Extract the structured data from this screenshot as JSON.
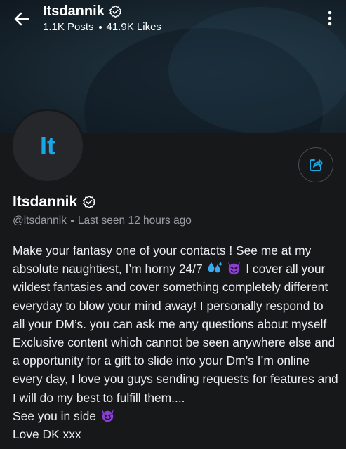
{
  "header": {
    "title": "Itsdannik",
    "posts": "1.1K Posts",
    "likes": "41.9K Likes"
  },
  "profile": {
    "initials": "It",
    "name": "Itsdannik",
    "handle": "@itsdannik",
    "last_seen": "Last seen 12 hours ago"
  },
  "bio": {
    "l1": "Make your fantasy one of your contacts ! See me at my",
    "l2a": "absolute naughtiest, I’m horny 24/7",
    "l2b": "I cover all your",
    "l3": "wildest fantasies and cover something completely different",
    "l4": "everyday to blow your mind away! I personally respond to",
    "l5": "all your DM’s. you can ask me any questions about myself",
    "l6": "Exclusive content which cannot be seen anywhere else and",
    "l7": "a opportunity for a gift to slide into your Dm’s I’m online",
    "l8": "every day, I love you guys sending requests for features and",
    "l9": "I will do my best to fulfill them....",
    "l10": "See you in side",
    "l11": "Love DK xxx"
  },
  "icons": {
    "back": "arrow-left-icon",
    "more": "more-vertical-icon",
    "verified": "verified-badge-icon",
    "share": "share-icon",
    "sweat": "sweat-droplets-emoji",
    "devil": "smiling-devil-emoji"
  },
  "colors": {
    "accent": "#1aa7e6",
    "background": "#17181a",
    "devil": "#8a3fd1"
  }
}
